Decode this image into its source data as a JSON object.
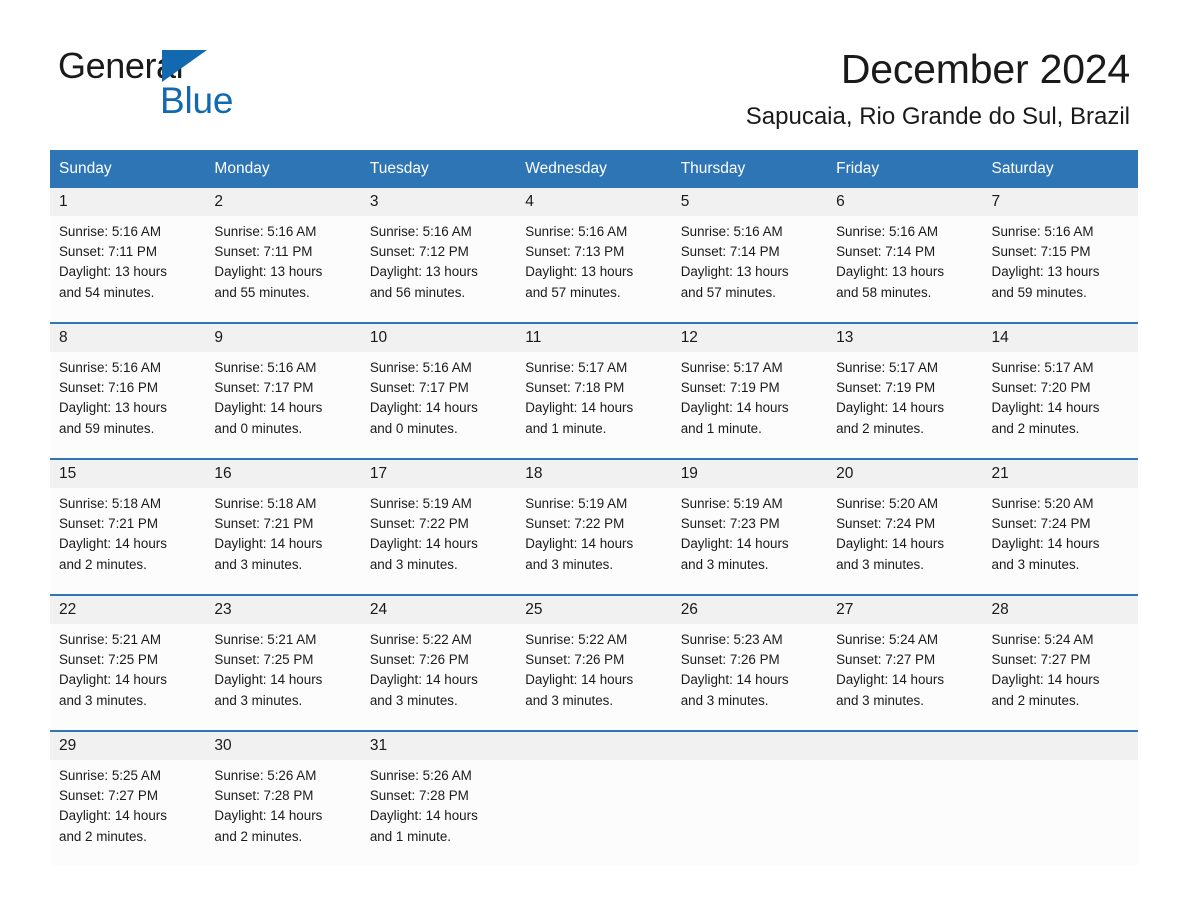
{
  "brand": {
    "name_part1": "General",
    "name_part2": "Blue",
    "accent_color": "#1269B0",
    "triangle_icon": "triangle-icon"
  },
  "header": {
    "title": "December 2024",
    "location": "Sapucaia, Rio Grande do Sul, Brazil"
  },
  "calendar": {
    "header_bg": "#2E75B6",
    "daynum_bg": "#F1F1F1",
    "weekdays": [
      "Sunday",
      "Monday",
      "Tuesday",
      "Wednesday",
      "Thursday",
      "Friday",
      "Saturday"
    ],
    "weeks": [
      [
        {
          "day": "1",
          "sunrise": "Sunrise: 5:16 AM",
          "sunset": "Sunset: 7:11 PM",
          "daylight_line1": "Daylight: 13 hours",
          "daylight_line2": "and 54 minutes."
        },
        {
          "day": "2",
          "sunrise": "Sunrise: 5:16 AM",
          "sunset": "Sunset: 7:11 PM",
          "daylight_line1": "Daylight: 13 hours",
          "daylight_line2": "and 55 minutes."
        },
        {
          "day": "3",
          "sunrise": "Sunrise: 5:16 AM",
          "sunset": "Sunset: 7:12 PM",
          "daylight_line1": "Daylight: 13 hours",
          "daylight_line2": "and 56 minutes."
        },
        {
          "day": "4",
          "sunrise": "Sunrise: 5:16 AM",
          "sunset": "Sunset: 7:13 PM",
          "daylight_line1": "Daylight: 13 hours",
          "daylight_line2": "and 57 minutes."
        },
        {
          "day": "5",
          "sunrise": "Sunrise: 5:16 AM",
          "sunset": "Sunset: 7:14 PM",
          "daylight_line1": "Daylight: 13 hours",
          "daylight_line2": "and 57 minutes."
        },
        {
          "day": "6",
          "sunrise": "Sunrise: 5:16 AM",
          "sunset": "Sunset: 7:14 PM",
          "daylight_line1": "Daylight: 13 hours",
          "daylight_line2": "and 58 minutes."
        },
        {
          "day": "7",
          "sunrise": "Sunrise: 5:16 AM",
          "sunset": "Sunset: 7:15 PM",
          "daylight_line1": "Daylight: 13 hours",
          "daylight_line2": "and 59 minutes."
        }
      ],
      [
        {
          "day": "8",
          "sunrise": "Sunrise: 5:16 AM",
          "sunset": "Sunset: 7:16 PM",
          "daylight_line1": "Daylight: 13 hours",
          "daylight_line2": "and 59 minutes."
        },
        {
          "day": "9",
          "sunrise": "Sunrise: 5:16 AM",
          "sunset": "Sunset: 7:17 PM",
          "daylight_line1": "Daylight: 14 hours",
          "daylight_line2": "and 0 minutes."
        },
        {
          "day": "10",
          "sunrise": "Sunrise: 5:16 AM",
          "sunset": "Sunset: 7:17 PM",
          "daylight_line1": "Daylight: 14 hours",
          "daylight_line2": "and 0 minutes."
        },
        {
          "day": "11",
          "sunrise": "Sunrise: 5:17 AM",
          "sunset": "Sunset: 7:18 PM",
          "daylight_line1": "Daylight: 14 hours",
          "daylight_line2": "and 1 minute."
        },
        {
          "day": "12",
          "sunrise": "Sunrise: 5:17 AM",
          "sunset": "Sunset: 7:19 PM",
          "daylight_line1": "Daylight: 14 hours",
          "daylight_line2": "and 1 minute."
        },
        {
          "day": "13",
          "sunrise": "Sunrise: 5:17 AM",
          "sunset": "Sunset: 7:19 PM",
          "daylight_line1": "Daylight: 14 hours",
          "daylight_line2": "and 2 minutes."
        },
        {
          "day": "14",
          "sunrise": "Sunrise: 5:17 AM",
          "sunset": "Sunset: 7:20 PM",
          "daylight_line1": "Daylight: 14 hours",
          "daylight_line2": "and 2 minutes."
        }
      ],
      [
        {
          "day": "15",
          "sunrise": "Sunrise: 5:18 AM",
          "sunset": "Sunset: 7:21 PM",
          "daylight_line1": "Daylight: 14 hours",
          "daylight_line2": "and 2 minutes."
        },
        {
          "day": "16",
          "sunrise": "Sunrise: 5:18 AM",
          "sunset": "Sunset: 7:21 PM",
          "daylight_line1": "Daylight: 14 hours",
          "daylight_line2": "and 3 minutes."
        },
        {
          "day": "17",
          "sunrise": "Sunrise: 5:19 AM",
          "sunset": "Sunset: 7:22 PM",
          "daylight_line1": "Daylight: 14 hours",
          "daylight_line2": "and 3 minutes."
        },
        {
          "day": "18",
          "sunrise": "Sunrise: 5:19 AM",
          "sunset": "Sunset: 7:22 PM",
          "daylight_line1": "Daylight: 14 hours",
          "daylight_line2": "and 3 minutes."
        },
        {
          "day": "19",
          "sunrise": "Sunrise: 5:19 AM",
          "sunset": "Sunset: 7:23 PM",
          "daylight_line1": "Daylight: 14 hours",
          "daylight_line2": "and 3 minutes."
        },
        {
          "day": "20",
          "sunrise": "Sunrise: 5:20 AM",
          "sunset": "Sunset: 7:24 PM",
          "daylight_line1": "Daylight: 14 hours",
          "daylight_line2": "and 3 minutes."
        },
        {
          "day": "21",
          "sunrise": "Sunrise: 5:20 AM",
          "sunset": "Sunset: 7:24 PM",
          "daylight_line1": "Daylight: 14 hours",
          "daylight_line2": "and 3 minutes."
        }
      ],
      [
        {
          "day": "22",
          "sunrise": "Sunrise: 5:21 AM",
          "sunset": "Sunset: 7:25 PM",
          "daylight_line1": "Daylight: 14 hours",
          "daylight_line2": "and 3 minutes."
        },
        {
          "day": "23",
          "sunrise": "Sunrise: 5:21 AM",
          "sunset": "Sunset: 7:25 PM",
          "daylight_line1": "Daylight: 14 hours",
          "daylight_line2": "and 3 minutes."
        },
        {
          "day": "24",
          "sunrise": "Sunrise: 5:22 AM",
          "sunset": "Sunset: 7:26 PM",
          "daylight_line1": "Daylight: 14 hours",
          "daylight_line2": "and 3 minutes."
        },
        {
          "day": "25",
          "sunrise": "Sunrise: 5:22 AM",
          "sunset": "Sunset: 7:26 PM",
          "daylight_line1": "Daylight: 14 hours",
          "daylight_line2": "and 3 minutes."
        },
        {
          "day": "26",
          "sunrise": "Sunrise: 5:23 AM",
          "sunset": "Sunset: 7:26 PM",
          "daylight_line1": "Daylight: 14 hours",
          "daylight_line2": "and 3 minutes."
        },
        {
          "day": "27",
          "sunrise": "Sunrise: 5:24 AM",
          "sunset": "Sunset: 7:27 PM",
          "daylight_line1": "Daylight: 14 hours",
          "daylight_line2": "and 3 minutes."
        },
        {
          "day": "28",
          "sunrise": "Sunrise: 5:24 AM",
          "sunset": "Sunset: 7:27 PM",
          "daylight_line1": "Daylight: 14 hours",
          "daylight_line2": "and 2 minutes."
        }
      ],
      [
        {
          "day": "29",
          "sunrise": "Sunrise: 5:25 AM",
          "sunset": "Sunset: 7:27 PM",
          "daylight_line1": "Daylight: 14 hours",
          "daylight_line2": "and 2 minutes."
        },
        {
          "day": "30",
          "sunrise": "Sunrise: 5:26 AM",
          "sunset": "Sunset: 7:28 PM",
          "daylight_line1": "Daylight: 14 hours",
          "daylight_line2": "and 2 minutes."
        },
        {
          "day": "31",
          "sunrise": "Sunrise: 5:26 AM",
          "sunset": "Sunset: 7:28 PM",
          "daylight_line1": "Daylight: 14 hours",
          "daylight_line2": "and 1 minute."
        },
        {
          "day": "",
          "sunrise": "",
          "sunset": "",
          "daylight_line1": "",
          "daylight_line2": ""
        },
        {
          "day": "",
          "sunrise": "",
          "sunset": "",
          "daylight_line1": "",
          "daylight_line2": ""
        },
        {
          "day": "",
          "sunrise": "",
          "sunset": "",
          "daylight_line1": "",
          "daylight_line2": ""
        },
        {
          "day": "",
          "sunrise": "",
          "sunset": "",
          "daylight_line1": "",
          "daylight_line2": ""
        }
      ]
    ]
  }
}
